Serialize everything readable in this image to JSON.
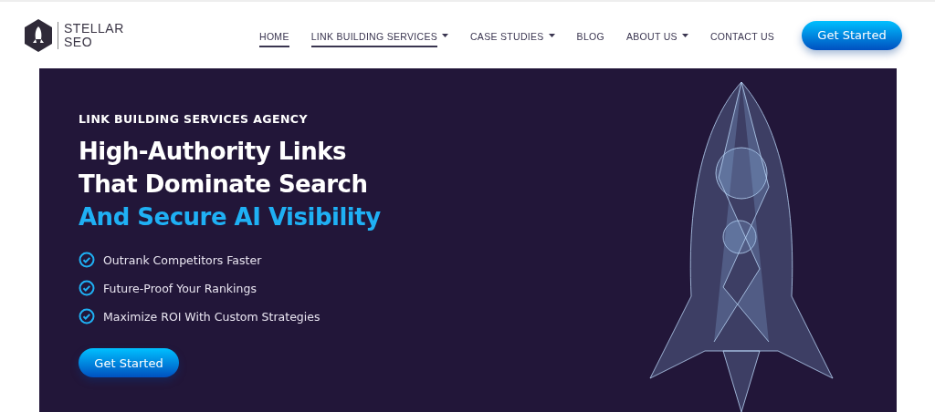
{
  "logo": {
    "line1": "STELLAR",
    "line2": "SEO"
  },
  "nav": [
    {
      "label": "HOME",
      "selected": true,
      "dropdown": false
    },
    {
      "label": "LINK BUILDING SERVICES",
      "selected": true,
      "dropdown": true
    },
    {
      "label": "CASE STUDIES",
      "selected": false,
      "dropdown": true
    },
    {
      "label": "BLOG",
      "selected": false,
      "dropdown": false
    },
    {
      "label": "ABOUT US",
      "selected": false,
      "dropdown": true
    },
    {
      "label": "CONTACT US",
      "selected": false,
      "dropdown": false
    }
  ],
  "header_button": "Get Started",
  "hero": {
    "eyebrow": "LINK BUILDING SERVICES AGENCY",
    "title_lines": [
      "High-Authority Links",
      "That Dominate Search"
    ],
    "title_highlight": "And Secure AI Visibility",
    "benefits": [
      "Outrank Competitors Faster",
      "Future-Proof Your Rankings",
      "Maximize ROI With Custom Strategies"
    ],
    "button": "Get Started"
  }
}
